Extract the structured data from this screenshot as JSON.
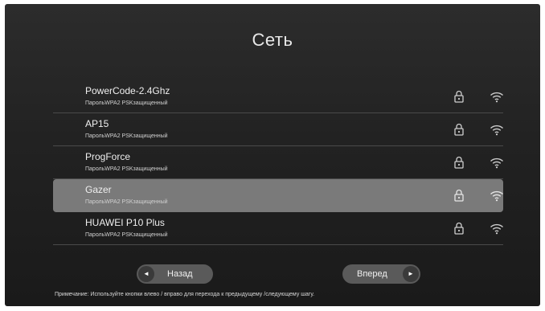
{
  "page_title": "Сеть",
  "networks": [
    {
      "ssid": "PowerCode-2.4Ghz",
      "security": "ПарольWPA2 PSKзащищенный",
      "selected": false
    },
    {
      "ssid": "AP15",
      "security": "ПарольWPA2 PSKзащищенный",
      "selected": false
    },
    {
      "ssid": "ProgForce",
      "security": "ПарольWPA2 PSKзащищенный",
      "selected": false
    },
    {
      "ssid": "Gazer",
      "security": "ПарольWPA2 PSKзащищенный",
      "selected": true
    },
    {
      "ssid": "HUAWEI P10 Plus",
      "security": "ПарольWPA2 PSKзащищенный",
      "selected": false
    }
  ],
  "icons": {
    "lock": "lock-icon",
    "wifi": "wifi-icon"
  },
  "nav": {
    "back_label": "Назад",
    "back_arrow": "◄",
    "next_label": "Вперед",
    "next_arrow": "►"
  },
  "note": "Примечание: Используйте кнопки влево / вправо для перехода к предыдущему /следующему шагу.",
  "colors": {
    "background": "#262626",
    "selected_row": "#7a7a7a",
    "button": "#5a5a5a"
  }
}
